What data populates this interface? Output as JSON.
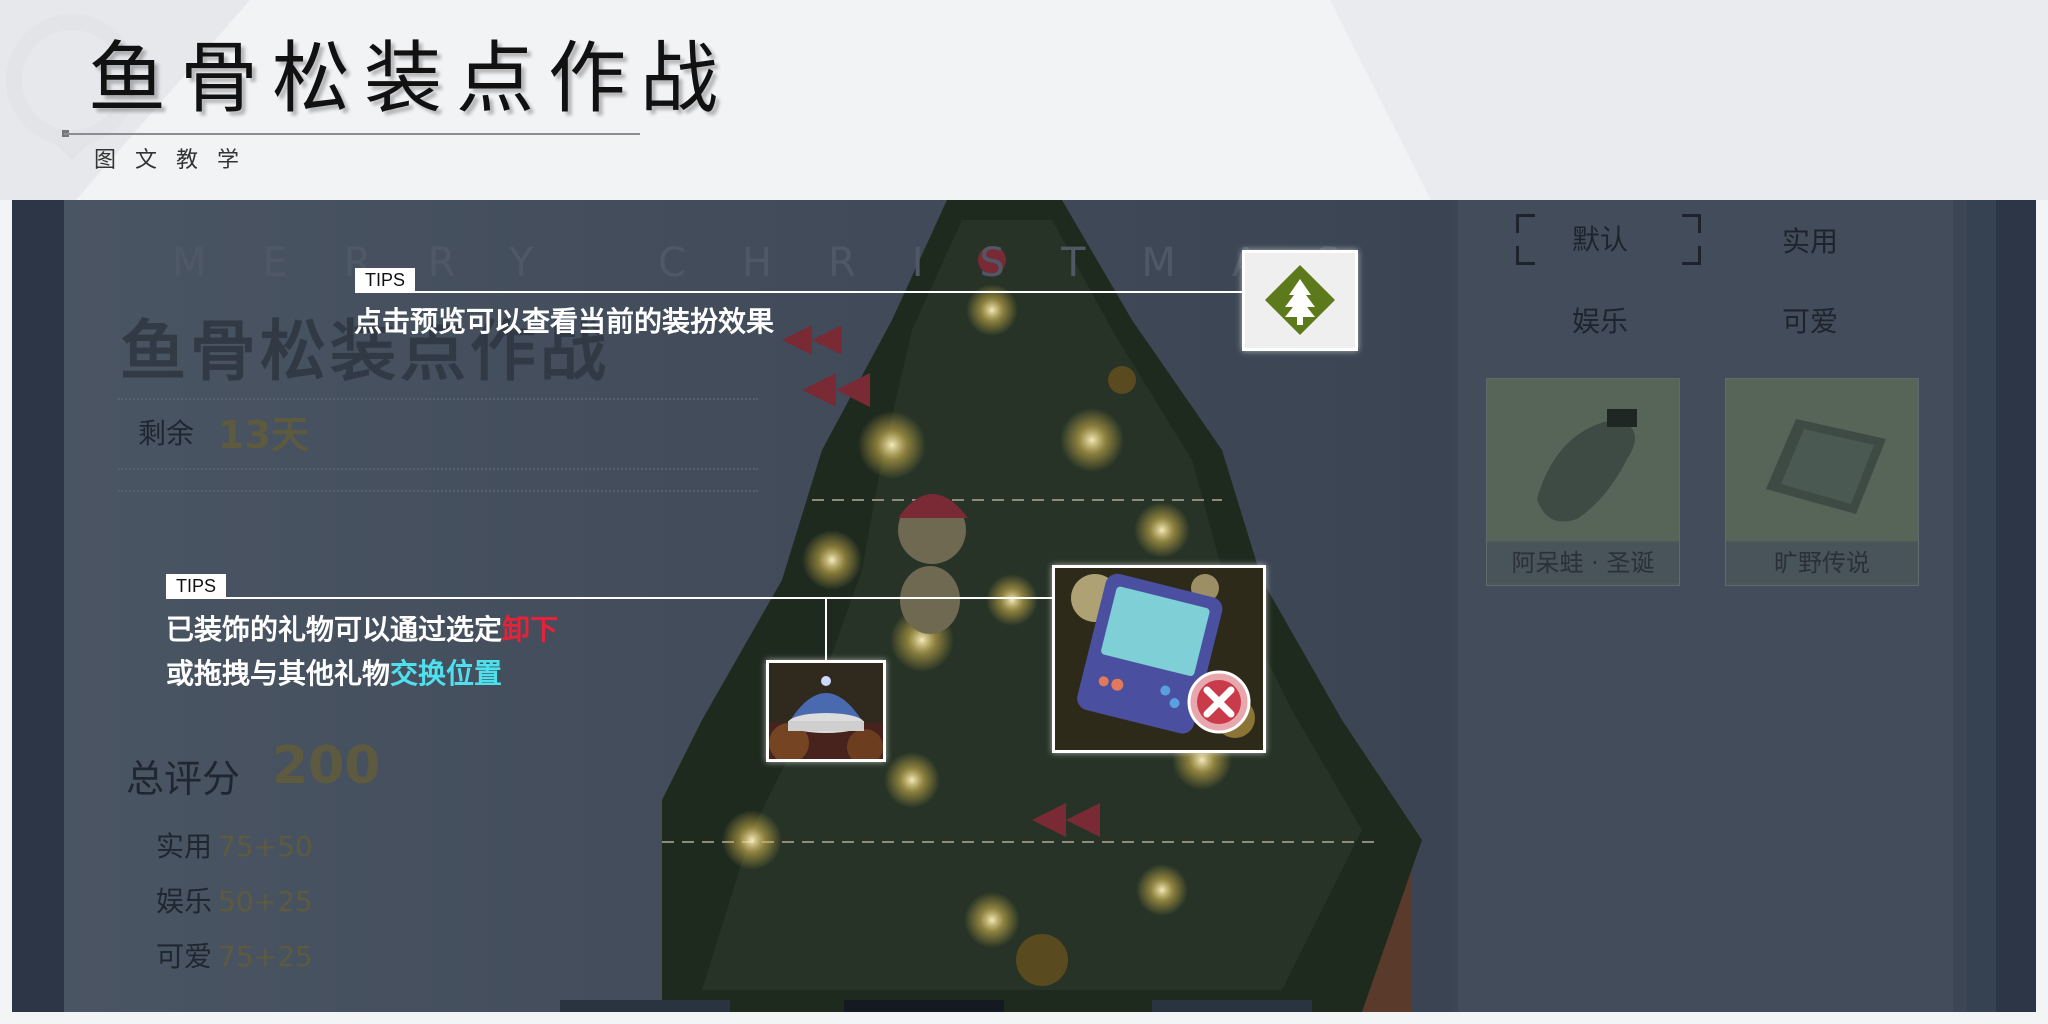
{
  "header": {
    "title": "鱼骨松装点作战",
    "subtitle": "图文教学"
  },
  "game": {
    "banner_text": "MERRY CHRISTMAS",
    "event_title": "鱼骨松装点作战",
    "remaining_label": "剩余",
    "remaining_value": "13天",
    "score_label": "总评分",
    "score_value": "200",
    "stats": [
      {
        "label": "实用",
        "value": "75+50"
      },
      {
        "label": "娱乐",
        "value": "50+25"
      },
      {
        "label": "可爱",
        "value": "75+25"
      }
    ],
    "filter_tabs": [
      "默认",
      "实用",
      "娱乐",
      "可爱"
    ],
    "active_tab": "默认",
    "items": [
      {
        "name": "阿呆蛙 · 圣诞"
      },
      {
        "name": "旷野传说"
      }
    ]
  },
  "tips": [
    {
      "tag": "TIPS",
      "text": "点击预览可以查看当前的装扮效果"
    },
    {
      "tag": "TIPS",
      "line1_a": "已装饰的礼物可以通过选定",
      "line1_b": "卸下",
      "line2_a": "或拖拽与其他礼物",
      "line2_b": "交换位置"
    }
  ],
  "colors": {
    "accent_red": "#e5223a",
    "accent_cyan": "#4fe0ee",
    "preview_icon_green": "#5c7a1c"
  },
  "icons": {
    "preview": "tree-diamond-icon",
    "remove": "close-circle-icon"
  }
}
